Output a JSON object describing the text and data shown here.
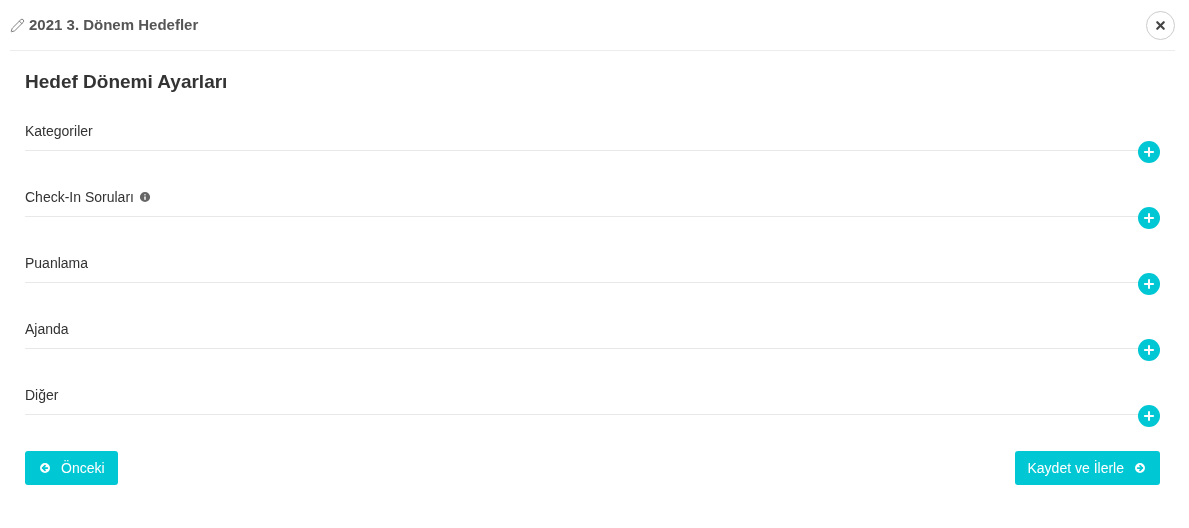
{
  "window": {
    "title": "2021 3. Dönem Hedefler"
  },
  "heading": "Hedef Dönemi Ayarları",
  "sections": [
    {
      "label": "Kategoriler",
      "has_info": false
    },
    {
      "label": "Check-In Soruları",
      "has_info": true
    },
    {
      "label": "Puanlama",
      "has_info": false
    },
    {
      "label": "Ajanda",
      "has_info": false
    },
    {
      "label": "Diğer",
      "has_info": false
    }
  ],
  "buttons": {
    "previous": "Önceki",
    "next": "Kaydet ve İlerle"
  }
}
